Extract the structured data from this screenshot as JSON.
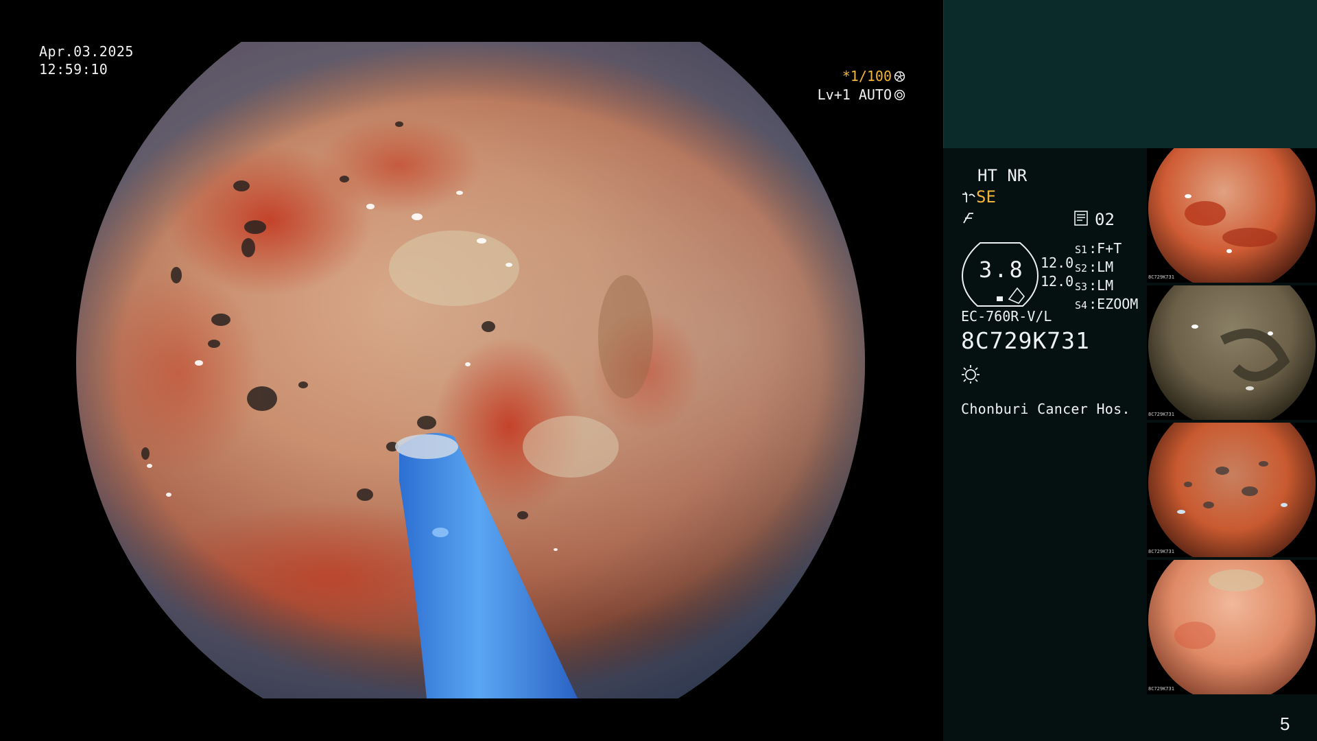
{
  "overlay": {
    "date": "Apr.03.2025",
    "time": "12:59:10",
    "shutter_speed": "*1/100",
    "shutter_icon": "aperture-icon",
    "level_mode": "Lv+1 AUTO",
    "auto_icon": "auto-target-icon"
  },
  "panel": {
    "mode": "HT NR",
    "se_label": "SE",
    "structure_icon": "structure-enhance-icon",
    "freeze_icon": "freeze-icon",
    "record_icon": "record-icon",
    "record_value": "02",
    "iris_value": "3.8",
    "value_1": "12.0",
    "value_2": "12.0",
    "switches": [
      {
        "num": "S1",
        "label": "F+T"
      },
      {
        "num": "S2",
        "label": "LM"
      },
      {
        "num": "S3",
        "label": "LM"
      },
      {
        "num": "S4",
        "label": "EZOOM"
      }
    ],
    "scope_model": "EC-760R-V/L",
    "scope_serial": "8C729K731",
    "light_icon": "light-source-icon",
    "hospital": "Chonburi Cancer Hos."
  },
  "thumbnails": [
    {
      "serial": "8C729K731"
    },
    {
      "serial": "8C729K731"
    },
    {
      "serial": "8C729K731"
    },
    {
      "serial": "8C729K731"
    }
  ],
  "page_number": "5",
  "colors": {
    "accent_yellow": "#f3b43a",
    "panel_teal": "#0b2a2a",
    "panel_dark": "#041110",
    "instrument_blue": "#3f8ee6"
  }
}
